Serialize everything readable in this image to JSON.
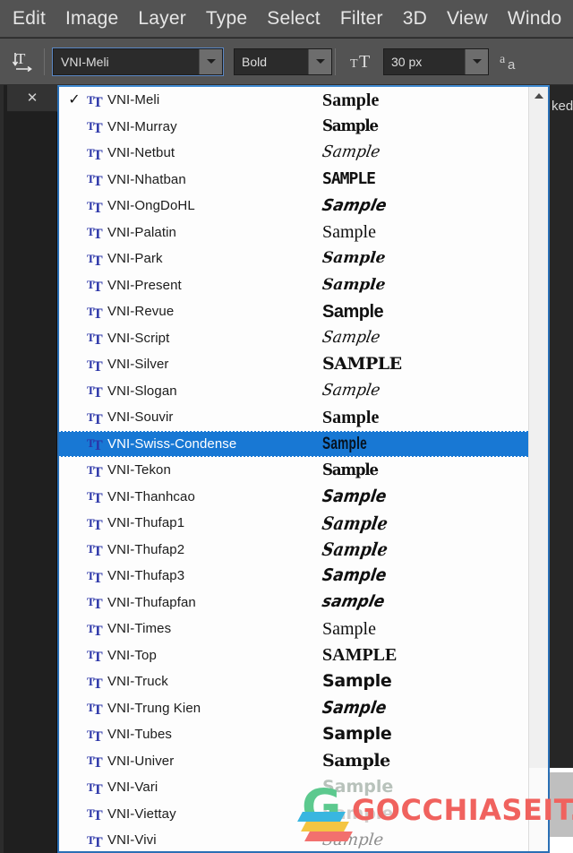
{
  "menubar": {
    "items": [
      "Edit",
      "Image",
      "Layer",
      "Type",
      "Select",
      "Filter",
      "3D",
      "View",
      "Windo"
    ]
  },
  "options_bar": {
    "orientation_icon": "text-orientation-icon",
    "font_family": {
      "value": "VNI-Meli",
      "arrow": "chevron-down-icon"
    },
    "font_style": {
      "value": "Bold",
      "arrow": "chevron-down-icon"
    },
    "size_icon": "font-size-icon",
    "font_size": {
      "value": "30 px",
      "arrow": "chevron-down-icon"
    },
    "antialias_icon": "anti-aliasing-icon"
  },
  "left_panel": {
    "close_label": "✕"
  },
  "right_strip": {
    "clipped_text": "ked"
  },
  "dropdown": {
    "checkmark": "✓",
    "tt_icon": "truetype-icon",
    "scrollbar": {
      "up_arrow": "chevron-up-icon"
    },
    "selected_index": 13,
    "checked_index": 0,
    "items": [
      {
        "name": "VNI-Meli",
        "sample": "Sample",
        "style": "s-serif"
      },
      {
        "name": "VNI-Murray",
        "sample": "Sample",
        "style": "s-slab"
      },
      {
        "name": "VNI-Netbut",
        "sample": "Sample",
        "style": "s-script-lt"
      },
      {
        "name": "VNI-Nhatban",
        "sample": "SAMPLE",
        "style": "s-deco"
      },
      {
        "name": "VNI-OngDoHL",
        "sample": "Sample",
        "style": "s-hand"
      },
      {
        "name": "VNI-Palatin",
        "sample": "Sample",
        "style": "s-serif-n"
      },
      {
        "name": "VNI-Park",
        "sample": "Sample",
        "style": "s-script"
      },
      {
        "name": "VNI-Present",
        "sample": "Sample",
        "style": "s-script"
      },
      {
        "name": "VNI-Revue",
        "sample": "Sample",
        "style": "s-sans-bb"
      },
      {
        "name": "VNI-Script",
        "sample": "Sample",
        "style": "s-script-lt"
      },
      {
        "name": "VNI-Silver",
        "sample": "SAMPLE",
        "style": "s-caps-d"
      },
      {
        "name": "VNI-Slogan",
        "sample": "Sample",
        "style": "s-script-lt"
      },
      {
        "name": "VNI-Souvir",
        "sample": "Sample",
        "style": "s-caps"
      },
      {
        "name": "VNI-Swiss-Condense",
        "sample": "Sample",
        "style": "s-cond"
      },
      {
        "name": "VNI-Tekon",
        "sample": "Sample",
        "style": "s-slab"
      },
      {
        "name": "VNI-Thanhcao",
        "sample": "Sample",
        "style": "s-brush"
      },
      {
        "name": "VNI-Thufap1",
        "sample": "Sample",
        "style": "s-brush2"
      },
      {
        "name": "VNI-Thufap2",
        "sample": "Sample",
        "style": "s-brush2"
      },
      {
        "name": "VNI-Thufap3",
        "sample": "Sample",
        "style": "s-brush"
      },
      {
        "name": "VNI-Thufapfan",
        "sample": "sample",
        "style": "s-hand"
      },
      {
        "name": "VNI-Times",
        "sample": "Sample",
        "style": "s-serif-n"
      },
      {
        "name": "VNI-Top",
        "sample": "SAMPLE",
        "style": "s-caps"
      },
      {
        "name": "VNI-Truck",
        "sample": "Sample",
        "style": "s-sans-b"
      },
      {
        "name": "VNI-Trung Kien",
        "sample": "Sample",
        "style": "s-brush"
      },
      {
        "name": "VNI-Tubes",
        "sample": "Sample",
        "style": "s-sans-b"
      },
      {
        "name": "VNI-Univer",
        "sample": "Sample",
        "style": "s-caps-d"
      },
      {
        "name": "VNI-Vari",
        "sample": "Sample",
        "style": "s-faint"
      },
      {
        "name": "VNI-Viettay",
        "sample": "Sample",
        "style": "s-faint2"
      },
      {
        "name": "VNI-Vivi",
        "sample": "Sample",
        "style": "s-thin-scr"
      }
    ]
  },
  "watermark": {
    "text": "GOCCHIASEIT.COM",
    "letter": "G",
    "color": "#f0625e"
  }
}
